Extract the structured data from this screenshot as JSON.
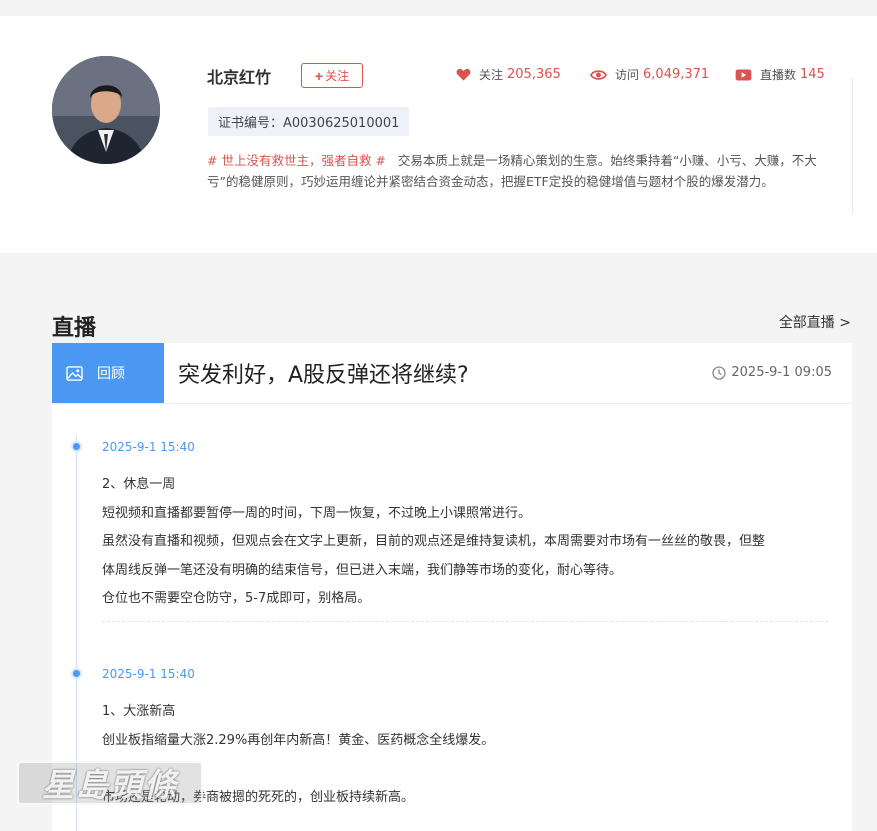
{
  "profile": {
    "name": "北京红竹",
    "follow_label": "关注",
    "stats": [
      {
        "icon": "heart-icon",
        "label": "关注",
        "value": "205,365",
        "color": "#d9534f"
      },
      {
        "icon": "eye-icon",
        "label": "访问",
        "value": "6,049,371",
        "color": "#d9534f"
      },
      {
        "icon": "video-icon",
        "label": "直播数",
        "value": "145",
        "color": "#d9534f"
      }
    ],
    "cert": "证书编号：A0030625010001",
    "bio_tag": "# 世上没有救世主，强者自救 #",
    "bio_text": "交易本质上就是一场精心策划的生意。始终秉持着“小赚、小亏、大赚，不大亏”的稳健原则，巧妙运用缠论并紧密结合资金动态，把握ETF定投的稳健增值与题材个股的爆发潜力。"
  },
  "live_section": {
    "title": "直播",
    "all_link": "全部直播 >",
    "card": {
      "badge": "回顾",
      "title": "突发利好，A股反弹还将继续?",
      "time": "2025-9-1 09:05"
    },
    "posts": [
      {
        "time": "2025-9-1 15:40",
        "lines": [
          "2、休息一周",
          "短视频和直播都要暂停一周的时间，下周一恢复，不过晚上小课照常进行。",
          "虽然没有直播和视频，但观点会在文字上更新，目前的观点还是维持复读机，本周需要对市场有一丝丝的敬畏，但整",
          "体周线反弹一笔还没有明确的结束信号，但已进入末端，我们静等市场的变化，耐心等待。",
          "仓位也不需要空仓防守，5-7成即可，别格局。"
        ]
      },
      {
        "time": "2025-9-1 15:40",
        "lines": [
          "1、大涨新高",
          "创业板指缩量大涨2.29%再创年内新高！黄金、医药概念全线爆发。",
          "",
          "市场还是轮动，券商被摁的死死的，创业板持续新高。"
        ]
      }
    ]
  },
  "watermark": "星島頭條",
  "colors": {
    "accent_blue": "#4a98f2",
    "accent_red": "#d9534f"
  }
}
